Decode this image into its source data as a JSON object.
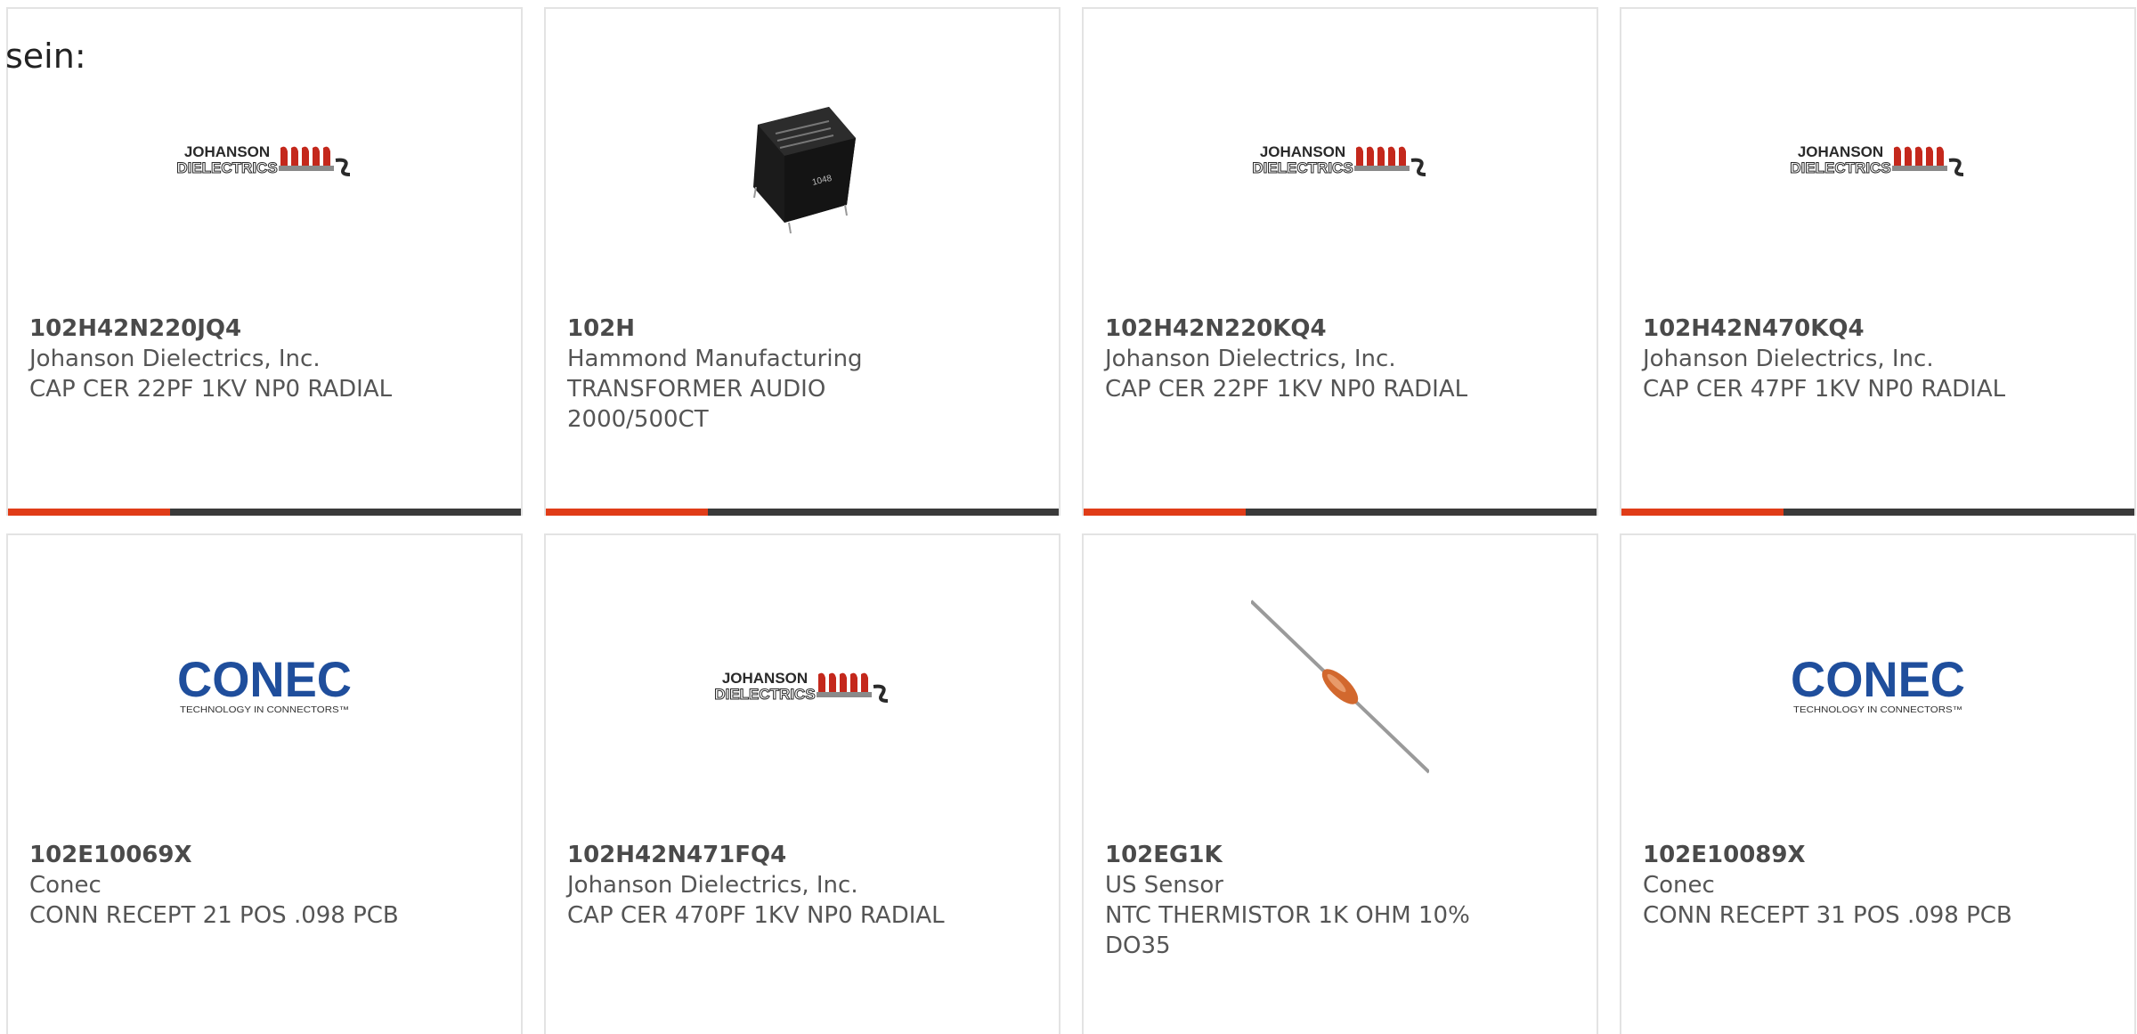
{
  "intro": {
    "text": "sein:"
  },
  "colors": {
    "accent": "#e03c18",
    "bar": "#3a3a3a",
    "border": "#e3e3e3",
    "johanson_red": "#c4281c",
    "conec_blue": "#1f4e9c"
  },
  "products": [
    {
      "part_number": "102H42N220JQ4",
      "manufacturer": "Johanson Dielectrics, Inc.",
      "description": "CAP CER 22PF 1KV NP0 RADIAL",
      "image": "johanson-logo",
      "logo_text_1": "JOHANSON",
      "logo_text_2": "DIELECTRICS"
    },
    {
      "part_number": "102H",
      "manufacturer": "Hammond Manufacturing",
      "description": "TRANSFORMER AUDIO 2000/500CT",
      "image": "transformer-photo"
    },
    {
      "part_number": "102H42N220KQ4",
      "manufacturer": "Johanson Dielectrics, Inc.",
      "description": "CAP CER 22PF 1KV NP0 RADIAL",
      "image": "johanson-logo",
      "logo_text_1": "JOHANSON",
      "logo_text_2": "DIELECTRICS"
    },
    {
      "part_number": "102H42N470KQ4",
      "manufacturer": "Johanson Dielectrics, Inc.",
      "description": "CAP CER 47PF 1KV NP0 RADIAL",
      "image": "johanson-logo",
      "logo_text_1": "JOHANSON",
      "logo_text_2": "DIELECTRICS"
    },
    {
      "part_number": "102E10069X",
      "manufacturer": "Conec",
      "description": "CONN RECEPT 21 POS .098 PCB",
      "image": "conec-logo",
      "logo_text_1": "CONEC",
      "logo_text_2": "TECHNOLOGY IN CONNECTORS™"
    },
    {
      "part_number": "102H42N471FQ4",
      "manufacturer": "Johanson Dielectrics, Inc.",
      "description": "CAP CER 470PF 1KV NP0 RADIAL",
      "image": "johanson-logo",
      "logo_text_1": "JOHANSON",
      "logo_text_2": "DIELECTRICS"
    },
    {
      "part_number": "102EG1K",
      "manufacturer": "US Sensor",
      "description": "NTC THERMISTOR 1K OHM 10% DO35",
      "image": "thermistor-photo"
    },
    {
      "part_number": "102E10089X",
      "manufacturer": "Conec",
      "description": "CONN RECEPT 31 POS .098 PCB",
      "image": "conec-logo",
      "logo_text_1": "CONEC",
      "logo_text_2": "TECHNOLOGY IN CONNECTORS™"
    }
  ]
}
